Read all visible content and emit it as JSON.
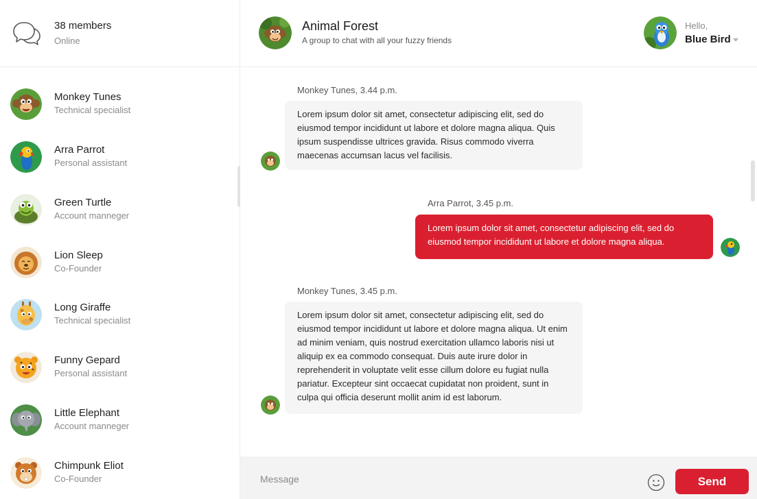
{
  "sidebar": {
    "icon": "chat-bubbles-icon",
    "members_count": "38 members",
    "members_status": "Online",
    "contacts": [
      {
        "name": "Monkey Tunes",
        "role": "Technical specialist",
        "icon": "monkey-avatar"
      },
      {
        "name": "Arra Parrot",
        "role": "Personal assistant",
        "icon": "parrot-avatar"
      },
      {
        "name": "Green Turtle",
        "role": "Account manneger",
        "icon": "turtle-avatar"
      },
      {
        "name": "Lion Sleep",
        "role": "Co-Founder",
        "icon": "lion-avatar"
      },
      {
        "name": "Long Giraffe",
        "role": "Technical specialist",
        "icon": "giraffe-avatar"
      },
      {
        "name": "Funny Gepard",
        "role": "Personal assistant",
        "icon": "cheetah-avatar"
      },
      {
        "name": "Little Elephant",
        "role": "Account manneger",
        "icon": "elephant-avatar"
      },
      {
        "name": "Chimpunk Eliot",
        "role": "Co-Founder",
        "icon": "chipmunk-avatar"
      }
    ]
  },
  "header": {
    "group_name": "Animal Forest",
    "group_desc": "A group to chat with all your fuzzy friends",
    "hello": "Hello,",
    "user_name": "Blue Bird"
  },
  "messages": [
    {
      "author": "Monkey Tunes, 3.44 p.m.",
      "direction": "in",
      "avatar": "monkey-avatar",
      "text": "Lorem ipsum dolor sit amet, consectetur adipiscing elit, sed do eiusmod tempor incididunt ut labore et dolore magna aliqua. Quis ipsum suspendisse ultrices gravida. Risus commodo viverra maecenas accumsan lacus vel facilisis."
    },
    {
      "author": "Arra Parrot, 3.45 p.m.",
      "direction": "out",
      "avatar": "parrot-avatar",
      "text": "Lorem ipsum dolor sit amet, consectetur adipiscing elit, sed do eiusmod tempor incididunt ut labore et dolore magna aliqua."
    },
    {
      "author": "Monkey Tunes, 3.45 p.m.",
      "direction": "in",
      "avatar": "monkey-avatar",
      "text": "Lorem ipsum dolor sit amet, consectetur adipiscing elit, sed do eiusmod tempor incididunt ut labore et dolore magna aliqua. Ut enim ad minim veniam, quis nostrud exercitation ullamco laboris nisi ut aliquip ex ea commodo consequat. Duis aute irure dolor in reprehenderit in voluptate velit esse cillum dolore eu fugiat nulla pariatur. Excepteur sint occaecat cupidatat non proident, sunt in culpa qui officia deserunt mollit anim id est laborum."
    }
  ],
  "compose": {
    "placeholder": "Message",
    "emoji_icon": "smiley-icon",
    "send_label": "Send"
  },
  "colors": {
    "accent": "#da2030",
    "bubble_in": "#f5f5f5",
    "muted_text": "#8a8a8a"
  }
}
